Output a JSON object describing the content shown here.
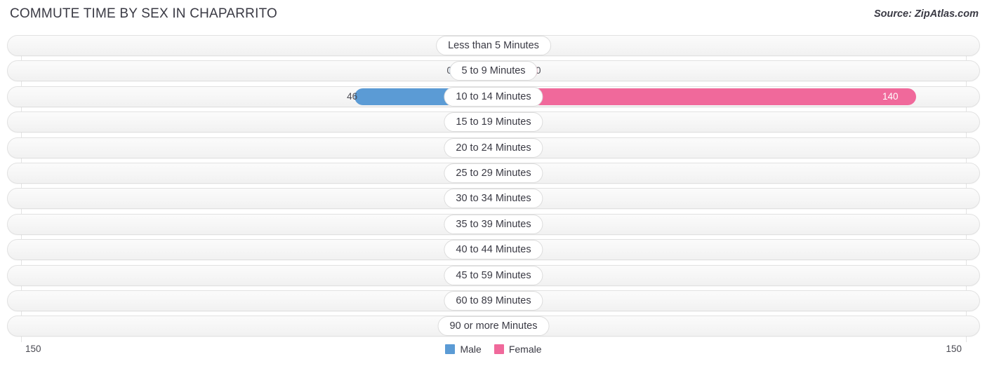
{
  "header": {
    "title": "COMMUTE TIME BY SEX IN CHAPARRITO",
    "source": "Source: ZipAtlas.com"
  },
  "legend": {
    "male_label": "Male",
    "female_label": "Female",
    "male_color": "#5b9bd5",
    "female_color": "#f0699b"
  },
  "axis": {
    "left_label": "150",
    "right_label": "150",
    "max": 150
  },
  "chart_data": {
    "type": "bar",
    "title": "COMMUTE TIME BY SEX IN CHAPARRITO",
    "orientation": "horizontal-diverging",
    "xlabel": "",
    "ylabel": "",
    "xlim": [
      150,
      150
    ],
    "grid": true,
    "legend_position": "bottom-center",
    "categories": [
      "Less than 5 Minutes",
      "5 to 9 Minutes",
      "10 to 14 Minutes",
      "15 to 19 Minutes",
      "20 to 24 Minutes",
      "25 to 29 Minutes",
      "30 to 34 Minutes",
      "35 to 39 Minutes",
      "40 to 44 Minutes",
      "45 to 59 Minutes",
      "60 to 89 Minutes",
      "90 or more Minutes"
    ],
    "series": [
      {
        "name": "Male",
        "color": "#5b9bd5",
        "values": [
          0,
          0,
          46,
          0,
          0,
          0,
          0,
          0,
          0,
          0,
          0,
          0
        ]
      },
      {
        "name": "Female",
        "color": "#f0699b",
        "values": [
          0,
          0,
          140,
          0,
          0,
          0,
          0,
          0,
          0,
          0,
          0,
          0
        ]
      }
    ]
  },
  "rows": [
    {
      "label": "Less than 5 Minutes",
      "male": "0",
      "female": "0"
    },
    {
      "label": "5 to 9 Minutes",
      "male": "0",
      "female": "0"
    },
    {
      "label": "10 to 14 Minutes",
      "male": "46",
      "female": "140"
    },
    {
      "label": "15 to 19 Minutes",
      "male": "0",
      "female": "0"
    },
    {
      "label": "20 to 24 Minutes",
      "male": "0",
      "female": "0"
    },
    {
      "label": "25 to 29 Minutes",
      "male": "0",
      "female": "0"
    },
    {
      "label": "30 to 34 Minutes",
      "male": "0",
      "female": "0"
    },
    {
      "label": "35 to 39 Minutes",
      "male": "0",
      "female": "0"
    },
    {
      "label": "40 to 44 Minutes",
      "male": "0",
      "female": "0"
    },
    {
      "label": "45 to 59 Minutes",
      "male": "0",
      "female": "0"
    },
    {
      "label": "60 to 89 Minutes",
      "male": "0",
      "female": "0"
    },
    {
      "label": "90 or more Minutes",
      "male": "0",
      "female": "0"
    }
  ]
}
